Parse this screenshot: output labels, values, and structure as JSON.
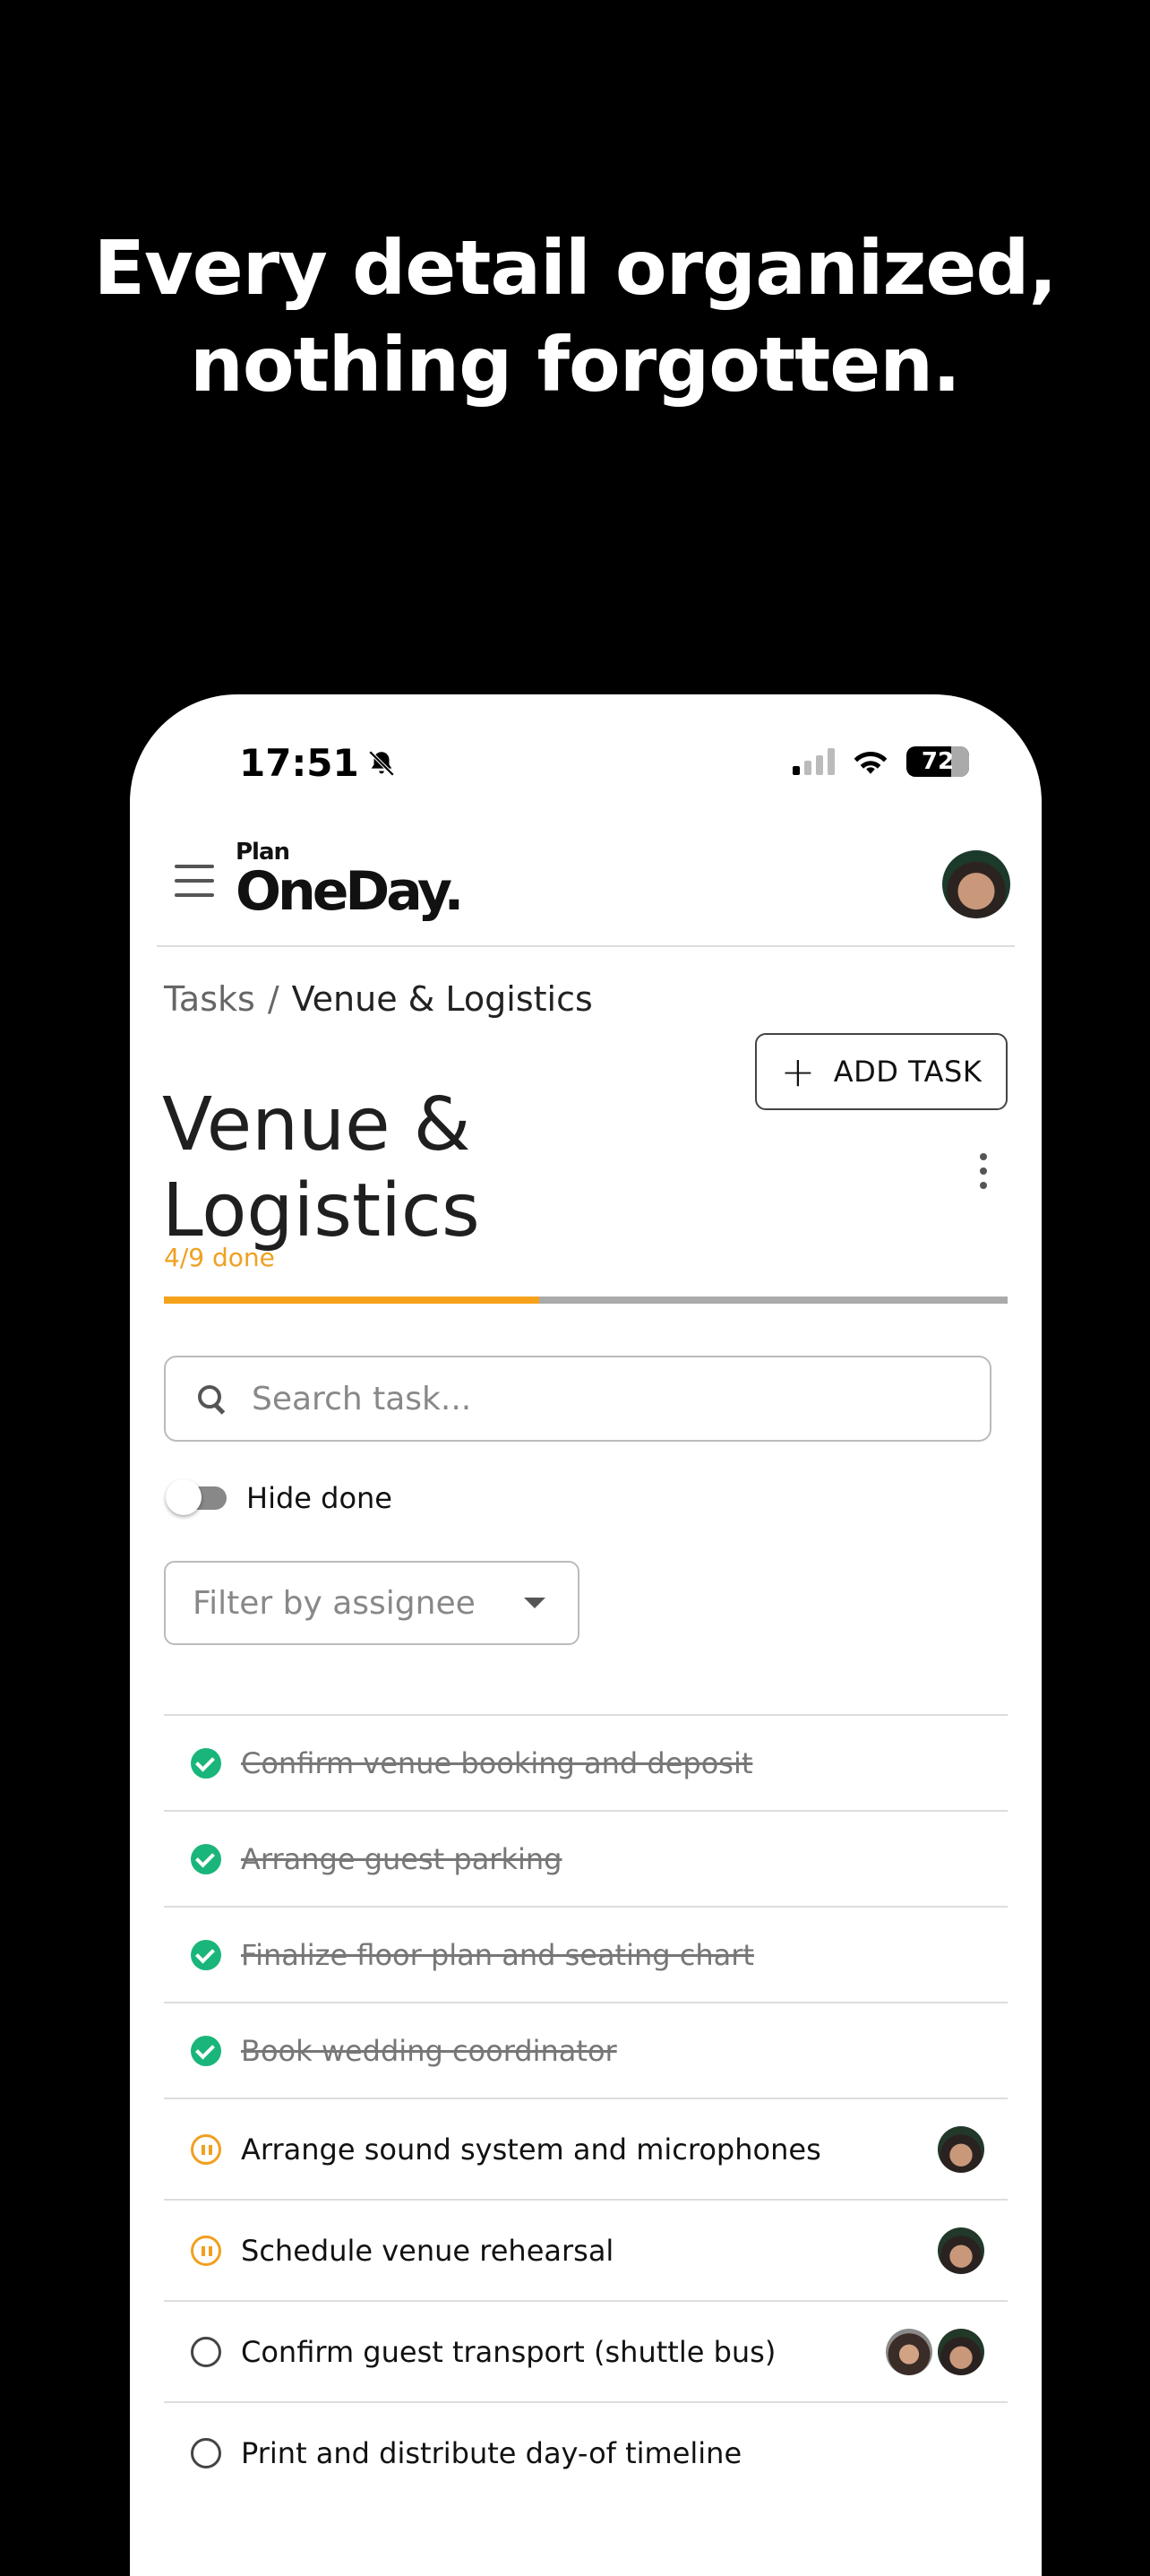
{
  "headline": {
    "line1": "Every detail organized,",
    "line2": "nothing forgotten."
  },
  "status_bar": {
    "time": "17:51",
    "battery": "72"
  },
  "app": {
    "logo_small": "Plan",
    "logo_big": "OneDay."
  },
  "breadcrumb": {
    "root": "Tasks",
    "separator": "/",
    "current": "Venue & Logistics"
  },
  "page": {
    "title": "Venue & Logistics",
    "add_button_label": "ADD TASK"
  },
  "progress": {
    "label": "4/9 done",
    "done": 4,
    "total": 9
  },
  "search": {
    "placeholder": "Search task..."
  },
  "hide_done": {
    "label": "Hide done",
    "on": false
  },
  "filter": {
    "placeholder": "Filter by assignee"
  },
  "tasks": [
    {
      "label": "Confirm venue booking and deposit",
      "status": "done"
    },
    {
      "label": "Arrange guest parking",
      "status": "done"
    },
    {
      "label": "Finalize floor plan and seating chart",
      "status": "done"
    },
    {
      "label": "Book wedding coordinator",
      "status": "done"
    },
    {
      "label": "Arrange sound system and microphones",
      "status": "in-progress"
    },
    {
      "label": "Schedule venue rehearsal",
      "status": "in-progress"
    },
    {
      "label": "Confirm guest transport (shuttle bus)",
      "status": "todo"
    },
    {
      "label": "Print and distribute day-of timeline",
      "status": "todo"
    }
  ],
  "colors": {
    "accent": "#f5a21a",
    "done_green": "#1ab57a"
  }
}
